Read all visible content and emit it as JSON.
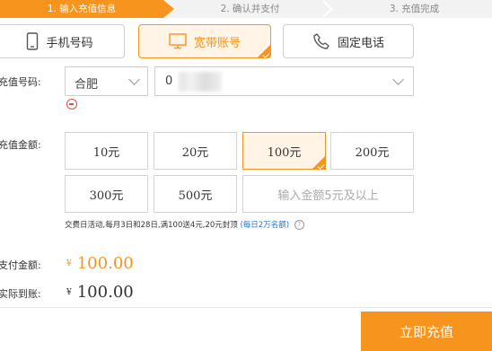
{
  "steps": [
    {
      "label": "1. 输入充值信息"
    },
    {
      "label": "2. 确认并支付"
    },
    {
      "label": "3. 充值完成"
    }
  ],
  "recharge_types": [
    {
      "label": "手机号码",
      "icon": "mobile-phone-icon"
    },
    {
      "label": "宽带账号",
      "icon": "monitor-icon",
      "selected": true
    },
    {
      "label": "固定电话",
      "icon": "telephone-icon"
    }
  ],
  "form": {
    "number_label": "充值号码:",
    "city_value": "合肥",
    "account_value": "0",
    "amount_label": "充值金额:"
  },
  "amounts": [
    {
      "label": "10元"
    },
    {
      "label": "20元"
    },
    {
      "label": "100元",
      "selected": true
    },
    {
      "label": "200元"
    },
    {
      "label": "300元"
    },
    {
      "label": "500元"
    }
  ],
  "custom_amount_placeholder": "输入金额5元及以上",
  "promo": {
    "text": "交费日活动,每月3日和28日,满100送4元,20元封顶",
    "link": "(每日2万名额)",
    "help_icon_glyph": "?"
  },
  "payment": {
    "pay_label": "支付金额:",
    "pay_currency": "¥",
    "pay_amount": "100.00",
    "actual_label": "实际到账:",
    "actual_currency": "¥",
    "actual_amount": "100.00"
  },
  "submit_label": "立即充值",
  "colors": {
    "accent": "#f7941d",
    "link": "#2b74c7",
    "error": "#e74c3c"
  }
}
